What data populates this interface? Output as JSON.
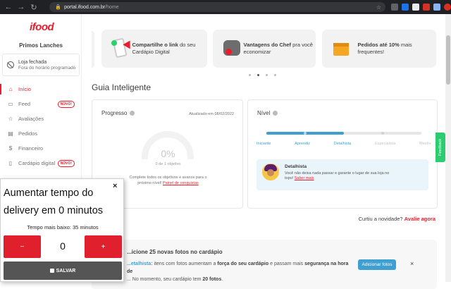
{
  "browser": {
    "host": "portal.ifood.com.br",
    "path": "/home"
  },
  "sidebar": {
    "logo": "ifood",
    "store_name": "Primos Lanches",
    "status_title": "Loja fechada",
    "status_desc": "Fora do horário programado",
    "items": [
      {
        "label": "Início",
        "badge": ""
      },
      {
        "label": "Feed",
        "badge": "NOVO!"
      },
      {
        "label": "Avaliações",
        "badge": ""
      },
      {
        "label": "Pedidos",
        "badge": ""
      },
      {
        "label": "Financeiro",
        "badge": ""
      },
      {
        "label": "Cardápio digital",
        "badge": "NOVO!"
      }
    ]
  },
  "promos": [
    {
      "bold": "Compartilhe o link",
      "rest": " do seu Cardápio Digital"
    },
    {
      "bold": "Vantagens do Chef",
      "rest": " pra você economizar"
    },
    {
      "bold": "Pedidos até 10%",
      "rest": " mais frequentes!"
    }
  ],
  "main": {
    "section_title": "Guia Inteligente",
    "progress": {
      "title": "Progresso",
      "updated": "Atualizado em 08/02/2022",
      "percent": "0%",
      "objectives": "0 de 1 objetivo",
      "desc": "Complete todos os objetivos e avance para o próximo nível!",
      "link": "Painel de conquistas",
      "value": 0
    },
    "level": {
      "title": "Nível",
      "levels": [
        "Iniciante",
        "Aprendiz",
        "Detalhista",
        "Especialista",
        "Mestre"
      ],
      "current_index": 2,
      "badge_title": "Detalhista",
      "badge_desc": "Você não deixa nada passar e garante o lugar de sua loja no topo!",
      "badge_link": "Saber mais"
    },
    "news_text": "Curtiu a novidade? ",
    "news_link": "Avalie agora",
    "task": {
      "title": "...icione 25 novas fotos no cardápio",
      "level": "...etalhista:",
      "desc_1": " itens com fotos aumentam a ",
      "bold_1": "força do seu cardápio",
      "desc_2": " e passam mais ",
      "bold_2": "segurança na hora de",
      "desc_3": "... No momento, seu cardápio tem ",
      "bold_3": "20 fotos",
      "desc_4": ".",
      "button": "Adicionar fotos",
      "close": "×"
    },
    "feedback": "Feedback"
  },
  "popup": {
    "title": "Aumentar tempo do delivery em 0 minutos",
    "subtitle": "Tempo mais baixo: 35 minutos",
    "minus": "−",
    "value": "0",
    "plus": "+",
    "save": "SALVAR",
    "close": "×"
  },
  "colors": {
    "brand": "#ea1d2c",
    "level_blue": "#3f9fd1",
    "save_gray": "#555555"
  }
}
